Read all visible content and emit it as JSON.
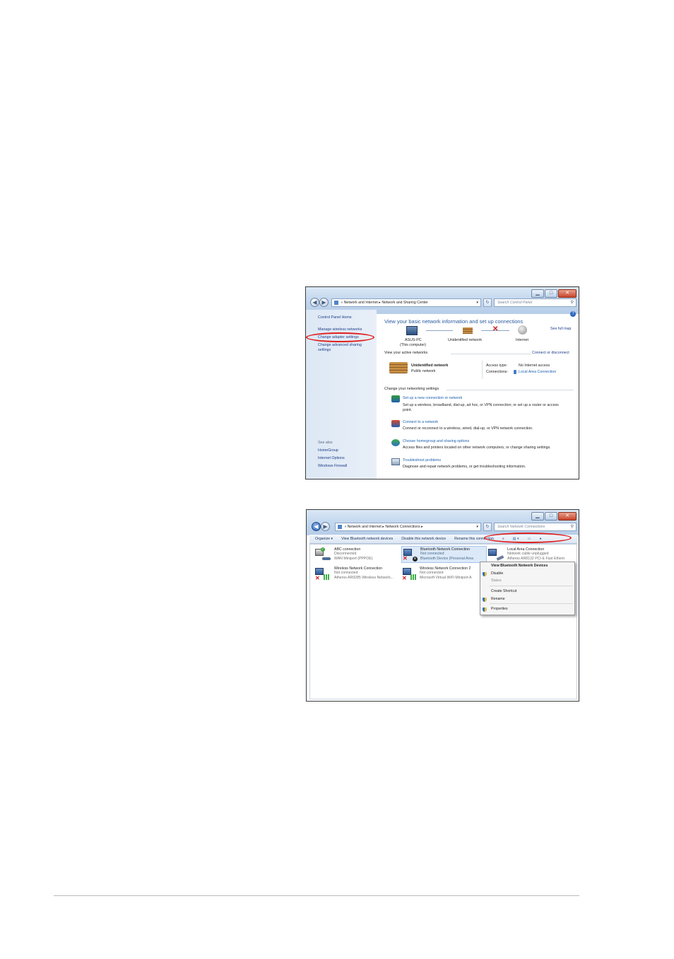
{
  "window1": {
    "breadcrumb": {
      "root": "Network and Internet",
      "sep": "▸",
      "current": "Network and Sharing Center"
    },
    "search_placeholder": "Search Control Panel",
    "sidebar": {
      "home": "Control Panel Home",
      "items": [
        "Manage wireless networks",
        "Change adapter settings",
        "Change advanced sharing",
        "settings"
      ],
      "see_also": "See also",
      "see_also_items": [
        "HomeGroup",
        "Internet Options",
        "Windows Firewall"
      ]
    },
    "main": {
      "title": "View your basic network information and set up connections",
      "see_full_map": "See full map",
      "map": {
        "computer": "ASUS-PC",
        "computer_sub": "(This computer)",
        "network": "Unidentified network",
        "internet": "Internet"
      },
      "active_networks_label": "View your active networks",
      "connect_or_disconnect": "Connect or disconnect",
      "active": {
        "name": "Unidentified network",
        "type": "Public network",
        "access_type_label": "Access type:",
        "access_type_value": "No Internet access",
        "connections_label": "Connections:",
        "connections_value": "Local Area Connection"
      },
      "change_settings_label": "Change your networking settings",
      "tasks": [
        {
          "link": "Set up a new connection or network",
          "desc": "Set up a wireless, broadband, dial-up, ad hoc, or VPN connection; or set up a router or access",
          "desc2": "point."
        },
        {
          "link": "Connect to a network",
          "desc": "Connect or reconnect to a wireless, wired, dial-up, or VPN network connection."
        },
        {
          "link": "Choose homegroup and sharing options",
          "desc": "Access files and printers located on other network computers, or change sharing settings."
        },
        {
          "link": "Troubleshoot problems",
          "desc": "Diagnose and repair network problems, or get troubleshooting information."
        }
      ]
    }
  },
  "window2": {
    "breadcrumb": {
      "root": "Network and Internet",
      "sep": "▸",
      "current": "Network Connections"
    },
    "search_placeholder": "Search Network Connections",
    "toolbar": {
      "organize": "Organize ▾",
      "view_bt": "View Bluetooth network devices",
      "disable": "Disable this network device",
      "rename": "Rename this connection",
      "more": "»"
    },
    "connections": [
      {
        "name": "ABC connection",
        "status": "Disconnected",
        "device": "WAN Miniport (PPPOE)"
      },
      {
        "name": "Bluetooth Network Connection",
        "status": "Not connected",
        "device": "Bluetooth Device (Personal Area"
      },
      {
        "name": "Local Area Connection",
        "status": "Network cable unplugged",
        "device": "Atheros AR8132 PCI-E Fast Ethern"
      },
      {
        "name": "Wireless Network Connection",
        "status": "Not connected",
        "device": "Atheros AR9285 Wireless Network..."
      },
      {
        "name": "Wireless Network Connection 2",
        "status": "Not connected",
        "device": "Microsoft Virtual WiFi Miniport A"
      }
    ],
    "context_menu": [
      "View Bluetooth Network Devices",
      "Disable",
      "Status",
      "Create Shortcut",
      "Rename",
      "Properties"
    ]
  },
  "colors": {
    "link": "#1f3e8a",
    "header": "#2a5a9e",
    "annotation": "#e02020"
  }
}
